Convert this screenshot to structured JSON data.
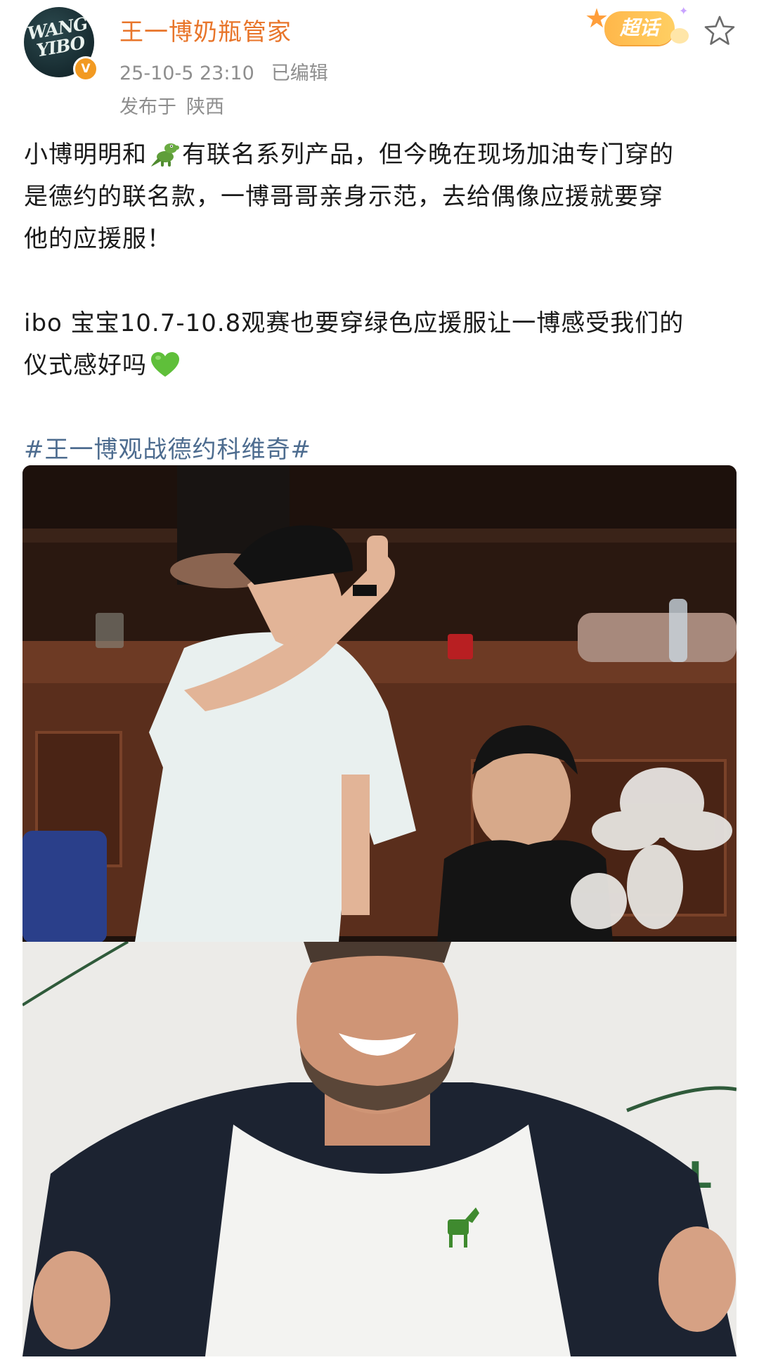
{
  "author": {
    "name": "王一博奶瓶管家",
    "avatar_text_line1": "WANG",
    "avatar_text_line2": "YIBO",
    "verified_badge": "V",
    "avatar_icon": "avatar-logo",
    "badge_color": "#f29a22"
  },
  "meta": {
    "timestamp": "25-10-5 23:10",
    "edited": "已编辑",
    "location_prefix": "发布于",
    "location": "陕西"
  },
  "header_actions": {
    "super_topic_label": "超话",
    "favorite_icon": "star-outline-icon"
  },
  "post": {
    "para1_part1": "小博明明和",
    "para1_emoji": "crocodile-emoji",
    "para1_part2": "有联名系列产品，但今晚在现场加油专门穿的",
    "para1_line2": "是德约的联名款，一博哥哥亲身示范，去给偶像应援就要穿",
    "para1_line3": "他的应援服！",
    "para2_line1": "ibo 宝宝10.7-10.8观赛也要穿绿色应援服让一博感受我们的",
    "para2_line2": "仪式感好吗",
    "para2_emoji": "green-heart-emoji",
    "hashtag": "#王一博观战德约科维奇#"
  },
  "images": {
    "bottom_sign_text": "B L"
  },
  "colors": {
    "username": "#e8752a",
    "meta": "#8e8e8e",
    "hashtag": "#4d6c8f",
    "super_topic": "#ffb74a"
  }
}
